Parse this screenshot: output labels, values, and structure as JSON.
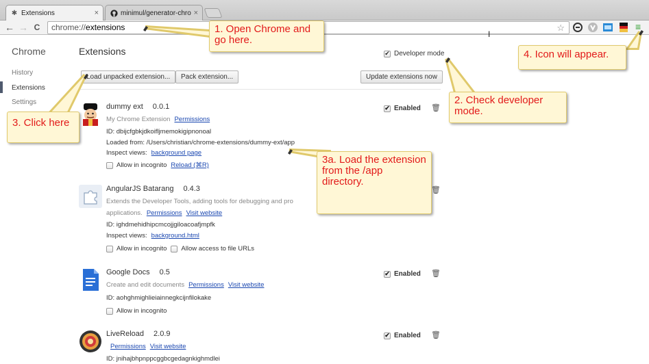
{
  "tabs": [
    {
      "title": "Extensions",
      "close": "×",
      "icon": "puzzle-icon"
    },
    {
      "title": "minimul/generator-chrome",
      "close": "×",
      "icon": "github-icon"
    }
  ],
  "toolbar": {
    "url_scheme": "chrome://",
    "url_host": "extensions",
    "star": "☆",
    "back": "←",
    "forward": "→",
    "reload": "C"
  },
  "sidebar": {
    "title": "Chrome",
    "items": [
      {
        "label": "History"
      },
      {
        "label": "Extensions"
      },
      {
        "label": "Settings"
      }
    ]
  },
  "main": {
    "title": "Extensions",
    "developer_mode_label": "Developer mode",
    "load_unpacked_button": "Load unpacked extension...",
    "pack_button": "Pack extension...",
    "update_button": "Update extensions now"
  },
  "extensions": [
    {
      "name": "dummy ext",
      "version": "0.0.1",
      "description": "My Chrome Extension",
      "permissions_link": "Permissions",
      "id": "ID: dbijcfgbkjdkoifljmemokigipnonoal",
      "loaded_from": "Loaded from: /Users/christian/chrome-extensions/dummy-ext/app",
      "inspect_label": "Inspect views:",
      "inspect_link": "background page",
      "incognito": "Allow in incognito",
      "reload_link": "Reload (⌘R)",
      "enabled": "Enabled"
    },
    {
      "name": "AngularJS Batarang",
      "version": "0.4.3",
      "description": "Extends the Developer Tools, adding tools for debugging and pro",
      "description2": "applications.",
      "permissions_link": "Permissions",
      "website_link": "Visit website",
      "id": "ID: ighdmehidhipcmcojjgiloacoafjmpfk",
      "inspect_label": "Inspect views:",
      "inspect_link": "background.html",
      "incognito": "Allow in incognito",
      "file_urls": "Allow access to file URLs"
    },
    {
      "name": "Google Docs",
      "version": "0.5",
      "description": "Create and edit documents",
      "permissions_link": "Permissions",
      "website_link": "Visit website",
      "id": "ID: aohghmighlieiainnegkcijnfilokake",
      "incognito": "Allow in incognito",
      "enabled": "Enabled"
    },
    {
      "name": "LiveReload",
      "version": "2.0.9",
      "permissions_link": "Permissions",
      "website_link": "Visit website",
      "id": "ID: jnihajbhpnppcggbcgedagnkighmdlei",
      "enabled": "Enabled"
    }
  ],
  "callouts": {
    "step1": "1. Open Chrome and go here.",
    "step2": "2. Check developer mode.",
    "step3": "3. Click here",
    "step3a": "3a. Load the extension from the /app directory.",
    "step4": "4. Icon will appear."
  },
  "colors": {
    "callout_text": "#e21a1a",
    "callout_bg": "#fff7d6",
    "link": "#1a47b0"
  }
}
